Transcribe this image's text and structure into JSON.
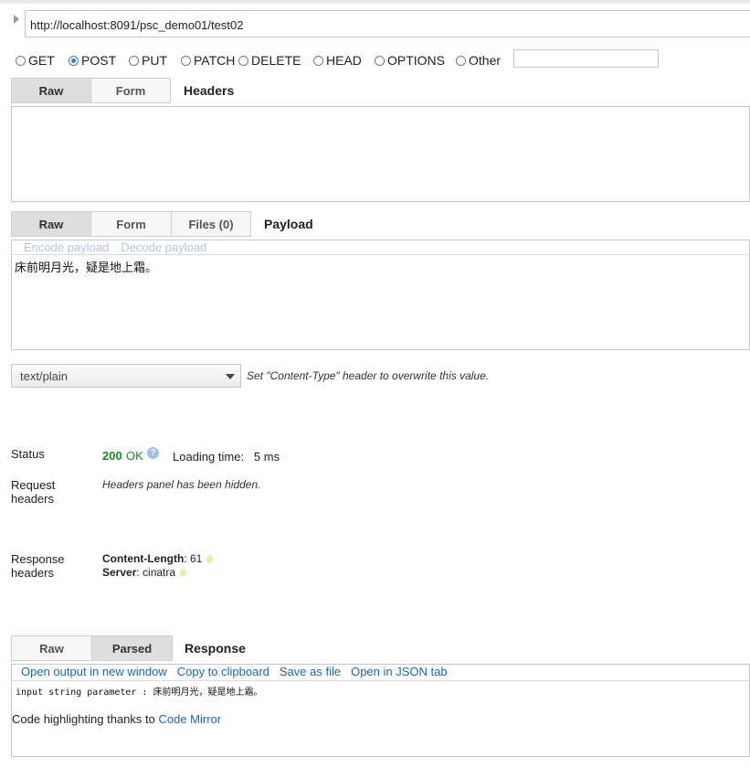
{
  "url": {
    "value": "http://localhost:8091/psc_demo01/test02"
  },
  "methods": {
    "get": "GET",
    "post": "POST",
    "put": "PUT",
    "patch": "PATCH",
    "delete": "DELETE",
    "head": "HEAD",
    "options": "OPTIONS",
    "other": "Other",
    "selected": "POST"
  },
  "headers_section": {
    "tabs": {
      "raw": "Raw",
      "form": "Form"
    },
    "title": "Headers",
    "active_tab": "Raw"
  },
  "payload_section": {
    "tabs": {
      "raw": "Raw",
      "form": "Form",
      "files": "Files (0)"
    },
    "title": "Payload",
    "active_tab": "Raw",
    "encode_link": "Encode payload",
    "decode_link": "Decode payload",
    "body": "床前明月光，疑是地上霜。"
  },
  "content_type": {
    "selected": "text/plain",
    "hint": "Set \"Content-Type\" header to overwrite this value."
  },
  "status": {
    "label": "Status",
    "code": "200",
    "text": "OK",
    "loading_label": "Loading time:",
    "loading_value": "5 ms"
  },
  "request_headers": {
    "label_line1": "Request",
    "label_line2": "headers",
    "note": "Headers panel has been hidden."
  },
  "response_headers": {
    "label_line1": "Response",
    "label_line2": "headers",
    "items": [
      {
        "name": "Content-Length",
        "value": "61"
      },
      {
        "name": "Server",
        "value": "cinatra"
      }
    ]
  },
  "response_section": {
    "tabs": {
      "raw": "Raw",
      "parsed": "Parsed"
    },
    "title": "Response",
    "active_tab": "Parsed",
    "links": {
      "open_window": "Open output in new window",
      "copy": "Copy to clipboard",
      "save": "Save as file",
      "json_tab": "Open in JSON tab"
    },
    "output": "input string parameter : 床前明月光，疑是地上霜。",
    "credit_text": "Code highlighting thanks to",
    "credit_link": "Code Mirror"
  },
  "colors": {
    "link": "#1a66c2",
    "status_ok": "#1e8a1e",
    "radio_selected": "#3b7cd6"
  },
  "icons": [
    "expand-arrow-icon",
    "help-icon",
    "bulb-icon",
    "dropdown-caret-icon"
  ]
}
